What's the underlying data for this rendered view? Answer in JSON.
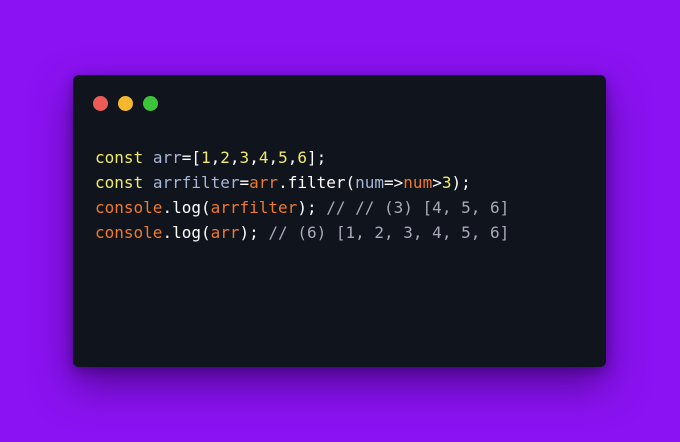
{
  "window": {
    "dots": [
      {
        "name": "close",
        "color": "#ec5b56"
      },
      {
        "name": "minimize",
        "color": "#f5b82e"
      },
      {
        "name": "maximize",
        "color": "#3cc53a"
      }
    ]
  },
  "code": {
    "lines": [
      [
        {
          "t": "const",
          "c": "kw"
        },
        {
          "t": " ",
          "c": "op"
        },
        {
          "t": "arr",
          "c": "id"
        },
        {
          "t": "=[",
          "c": "op"
        },
        {
          "t": "1",
          "c": "num"
        },
        {
          "t": ",",
          "c": "op"
        },
        {
          "t": "2",
          "c": "num"
        },
        {
          "t": ",",
          "c": "op"
        },
        {
          "t": "3",
          "c": "num"
        },
        {
          "t": ",",
          "c": "op"
        },
        {
          "t": "4",
          "c": "num"
        },
        {
          "t": ",",
          "c": "op"
        },
        {
          "t": "5",
          "c": "num"
        },
        {
          "t": ",",
          "c": "op"
        },
        {
          "t": "6",
          "c": "num"
        },
        {
          "t": "];",
          "c": "op"
        }
      ],
      [
        {
          "t": "const",
          "c": "kw"
        },
        {
          "t": " ",
          "c": "op"
        },
        {
          "t": "arrfilter",
          "c": "id"
        },
        {
          "t": "=",
          "c": "op"
        },
        {
          "t": "arr",
          "c": "obj"
        },
        {
          "t": ".filter(",
          "c": "fn"
        },
        {
          "t": "num",
          "c": "param"
        },
        {
          "t": "=>",
          "c": "op"
        },
        {
          "t": "num",
          "c": "obj"
        },
        {
          "t": ">",
          "c": "op"
        },
        {
          "t": "3",
          "c": "num"
        },
        {
          "t": ");",
          "c": "op"
        }
      ],
      [
        {
          "t": "console",
          "c": "obj"
        },
        {
          "t": ".log(",
          "c": "fn"
        },
        {
          "t": "arrfilter",
          "c": "obj"
        },
        {
          "t": "); ",
          "c": "op"
        },
        {
          "t": "// // (3) [4, 5, 6]",
          "c": "cm"
        }
      ],
      [
        {
          "t": "console",
          "c": "obj"
        },
        {
          "t": ".log(",
          "c": "fn"
        },
        {
          "t": "arr",
          "c": "obj"
        },
        {
          "t": "); ",
          "c": "op"
        },
        {
          "t": "// (6) [1, 2, 3, 4, 5, 6]",
          "c": "cm"
        }
      ]
    ]
  }
}
